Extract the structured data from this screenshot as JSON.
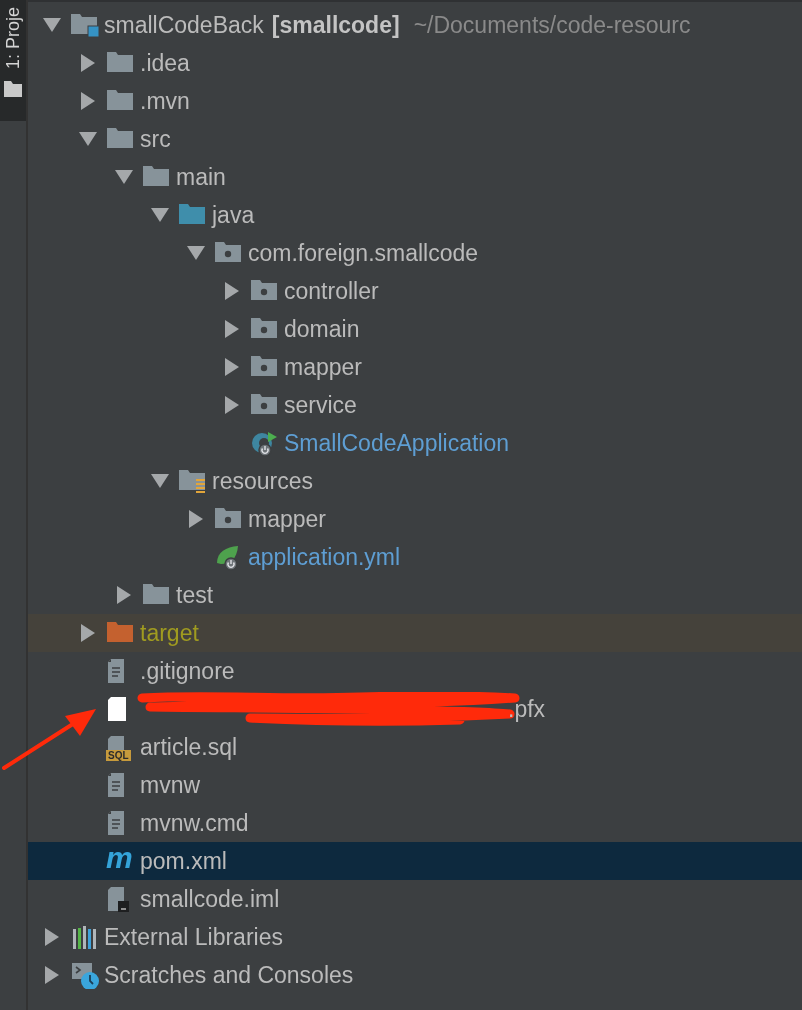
{
  "tool_strip": {
    "tab": {
      "label": "1: Proje",
      "selected": true
    }
  },
  "tree": [
    {
      "kind": "project",
      "label": "smallCodeBack",
      "module": "[smallcode]",
      "path": "~/Documents/code-resourc",
      "expanded": true,
      "selected": false,
      "children": [
        {
          "kind": "folder",
          "label": ".idea",
          "expanded": false,
          "selected": false
        },
        {
          "kind": "folder",
          "label": ".mvn",
          "expanded": false,
          "selected": false
        },
        {
          "kind": "folder",
          "label": "src",
          "expanded": true,
          "selected": false,
          "children": [
            {
              "kind": "folder",
              "label": "main",
              "expanded": true,
              "selected": false,
              "children": [
                {
                  "kind": "source",
                  "label": "java",
                  "expanded": true,
                  "selected": false,
                  "children": [
                    {
                      "kind": "package",
                      "label": "com.foreign.smallcode",
                      "expanded": true,
                      "selected": false,
                      "children": [
                        {
                          "kind": "package",
                          "label": "controller",
                          "expanded": false,
                          "selected": false
                        },
                        {
                          "kind": "package",
                          "label": "domain",
                          "expanded": false,
                          "selected": false
                        },
                        {
                          "kind": "package",
                          "label": "mapper",
                          "expanded": false,
                          "selected": false
                        },
                        {
                          "kind": "package",
                          "label": "service",
                          "expanded": false,
                          "selected": false
                        },
                        {
                          "kind": "spring-class",
                          "label": "SmallCodeApplication",
                          "color": "#5e9ed3",
                          "selected": false
                        }
                      ]
                    }
                  ]
                },
                {
                  "kind": "resources",
                  "label": "resources",
                  "expanded": true,
                  "selected": false,
                  "children": [
                    {
                      "kind": "package",
                      "label": "mapper",
                      "expanded": false,
                      "selected": false
                    },
                    {
                      "kind": "spring-config",
                      "label": "application.yml",
                      "color": "#5e9ed3",
                      "selected": false
                    }
                  ]
                }
              ]
            },
            {
              "kind": "folder",
              "label": "test",
              "expanded": false,
              "selected": false
            }
          ]
        },
        {
          "kind": "excluded",
          "label": "target",
          "color": "#a09b20",
          "expanded": false,
          "selected": false
        },
        {
          "kind": "text",
          "label": ".gitignore",
          "selected": false
        },
        {
          "kind": "blank",
          "label": ".pfx",
          "redacted": true,
          "selected": false
        },
        {
          "kind": "sql",
          "label": "article.sql",
          "badge": "SQL",
          "selected": false
        },
        {
          "kind": "text",
          "label": "mvnw",
          "selected": false
        },
        {
          "kind": "text",
          "label": "mvnw.cmd",
          "selected": false
        },
        {
          "kind": "maven",
          "label": "pom.xml",
          "glyph": "m",
          "selected": true
        },
        {
          "kind": "module",
          "label": "smallcode.iml",
          "selected": false
        }
      ]
    },
    {
      "kind": "libraries",
      "label": "External Libraries",
      "expanded": false,
      "selected": false
    },
    {
      "kind": "scratches",
      "label": "Scratches and Consoles",
      "expanded": false,
      "selected": false
    }
  ],
  "annotation": {
    "arrow": true
  }
}
